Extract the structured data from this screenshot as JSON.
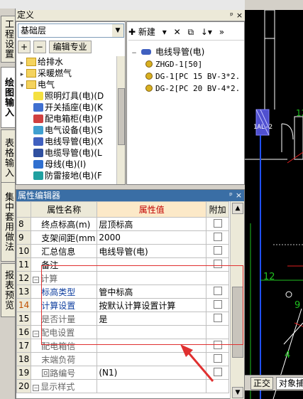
{
  "vtabs": [
    "工程设置",
    "绘图输入",
    "表格输入",
    "集中套用做法",
    "报表预览"
  ],
  "def_panel": {
    "title": "定义",
    "floor": "基础层",
    "edit_spec": "编辑专业",
    "tree": [
      {
        "label": "给排水",
        "level": 1
      },
      {
        "label": "采暖燃气",
        "level": 1
      },
      {
        "label": "电气",
        "level": 1
      },
      {
        "label": "照明灯具(电)(D",
        "level": 2
      },
      {
        "label": "开关插座(电)(K",
        "level": 2
      },
      {
        "label": "配电箱柜(电)(P",
        "level": 2
      },
      {
        "label": "电气设备(电)(S",
        "level": 2
      },
      {
        "label": "电线导管(电)(X",
        "level": 2
      },
      {
        "label": "电缆导管(电)(L",
        "level": 2
      },
      {
        "label": "母线(电)(I)",
        "level": 2
      },
      {
        "label": "防雷接地(电)(F",
        "level": 2
      }
    ]
  },
  "right_panel": {
    "new_label": "新建",
    "root": "电线导管(电)",
    "items": [
      "ZHGD-1[50]",
      "DG-1[PC 15 BV-3*2.",
      "DG-2[PC 20 BV-4*2."
    ]
  },
  "prop_editor": {
    "title": "属性编辑器",
    "col_name": "属性名称",
    "col_value": "属性值",
    "col_add": "附加",
    "rows": [
      {
        "num": "8",
        "name": "终点标高(m)",
        "value": "层顶标高",
        "check": true
      },
      {
        "num": "9",
        "name": "支架间距(mm",
        "value": "2000",
        "check": true
      },
      {
        "num": "10",
        "name": "汇总信息",
        "value": "电线导管(电)",
        "check": true
      },
      {
        "num": "11",
        "name": "备注",
        "value": "",
        "check": true
      },
      {
        "num": "12",
        "name": "计算",
        "value": "",
        "check": false,
        "group": true
      },
      {
        "num": "13",
        "name": "标高类型",
        "value": "管中标高",
        "check": true,
        "sub": true
      },
      {
        "num": "14",
        "name": "计算设置",
        "value": "按默认计算设置计算",
        "check": true,
        "sub": true,
        "selected": true
      },
      {
        "num": "15",
        "name": "是否计量",
        "value": "是",
        "check": true,
        "sub": true
      },
      {
        "num": "16",
        "name": "配电设置",
        "value": "",
        "check": false,
        "group": true
      },
      {
        "num": "17",
        "name": "配电箱信",
        "value": "",
        "check": true,
        "sub": true
      },
      {
        "num": "18",
        "name": "末端负荷",
        "value": "",
        "check": true,
        "sub": true
      },
      {
        "num": "19",
        "name": "回路编号",
        "value": "(N1)",
        "check": true,
        "sub": true
      },
      {
        "num": "20",
        "name": "显示样式",
        "value": "",
        "check": false,
        "group": true
      }
    ]
  },
  "cad": {
    "labels": [
      "1AL-2",
      "12",
      "4",
      "9",
      "12"
    ],
    "tabs": [
      "正交",
      "对象捕"
    ]
  },
  "colors": {
    "accent": "#3a6ea5",
    "highlight": "#e03030",
    "cad_bg": "#000000"
  }
}
